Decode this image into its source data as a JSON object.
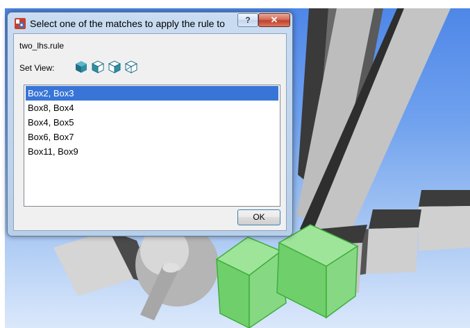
{
  "dialog": {
    "title": "Select one of the matches to apply the rule to",
    "help_label": "?",
    "close_label": "✕",
    "file_name": "two_lhs.rule",
    "set_view_label": "Set View:",
    "view_buttons": [
      {
        "icon": "solid-cube-icon"
      },
      {
        "icon": "shaded-cube-icon"
      },
      {
        "icon": "wireframe-cube-icon"
      },
      {
        "icon": "outline-cube-icon"
      }
    ],
    "matches": [
      {
        "label": "Box2, Box3",
        "selected": true
      },
      {
        "label": "Box8, Box4",
        "selected": false
      },
      {
        "label": "Box4, Box5",
        "selected": false
      },
      {
        "label": "Box6, Box7",
        "selected": false
      },
      {
        "label": "Box11, Box9",
        "selected": false
      }
    ],
    "ok_label": "OK"
  },
  "colors": {
    "selection": "#3875d7",
    "highlight_green": "#7ddc7a",
    "sky_top": "#4f87e8"
  }
}
